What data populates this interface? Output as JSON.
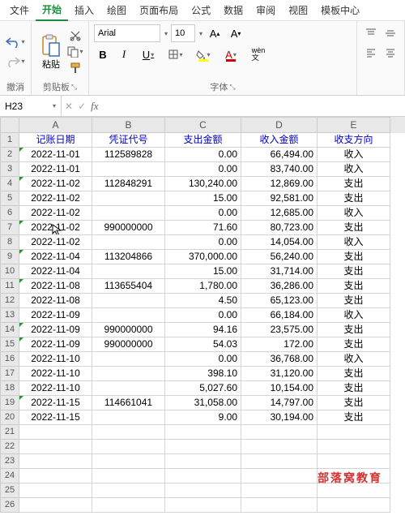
{
  "menu": [
    "文件",
    "开始",
    "插入",
    "绘图",
    "页面布局",
    "公式",
    "数据",
    "审阅",
    "视图",
    "模板中心"
  ],
  "menu_active": 1,
  "ribbon": {
    "undo_label": "撤消",
    "clipboard_label": "剪贴板",
    "paste_label": "粘贴",
    "font_label": "字体",
    "font_name": "Arial",
    "font_size": "10",
    "wen_label": "wèn\n文"
  },
  "cell_ref": "H23",
  "columns": [
    "A",
    "B",
    "C",
    "D",
    "E"
  ],
  "headers": [
    "记账日期",
    "凭证代号",
    "支出金额",
    "收入金额",
    "收支方向"
  ],
  "rows": [
    {
      "d": "2022-11-01",
      "v": "112589828",
      "o": "0.00",
      "i": "66,494.00",
      "t": "收入",
      "f": true
    },
    {
      "d": "2022-11-01",
      "v": "",
      "o": "0.00",
      "i": "83,740.00",
      "t": "收入"
    },
    {
      "d": "2022-11-02",
      "v": "112848291",
      "o": "130,240.00",
      "i": "12,869.00",
      "t": "支出",
      "f": true
    },
    {
      "d": "2022-11-02",
      "v": "",
      "o": "15.00",
      "i": "92,581.00",
      "t": "支出"
    },
    {
      "d": "2022-11-02",
      "v": "",
      "o": "0.00",
      "i": "12,685.00",
      "t": "收入"
    },
    {
      "d": "2022-11-02",
      "v": "990000000",
      "o": "71.60",
      "i": "80,723.00",
      "t": "支出",
      "f": true,
      "cursor": true
    },
    {
      "d": "2022-11-02",
      "v": "",
      "o": "0.00",
      "i": "14,054.00",
      "t": "收入"
    },
    {
      "d": "2022-11-04",
      "v": "113204866",
      "o": "370,000.00",
      "i": "56,240.00",
      "t": "支出",
      "f": true
    },
    {
      "d": "2022-11-04",
      "v": "",
      "o": "15.00",
      "i": "31,714.00",
      "t": "支出"
    },
    {
      "d": "2022-11-08",
      "v": "113655404",
      "o": "1,780.00",
      "i": "36,286.00",
      "t": "支出",
      "f": true
    },
    {
      "d": "2022-11-08",
      "v": "",
      "o": "4.50",
      "i": "65,123.00",
      "t": "支出"
    },
    {
      "d": "2022-11-09",
      "v": "",
      "o": "0.00",
      "i": "66,184.00",
      "t": "收入"
    },
    {
      "d": "2022-11-09",
      "v": "990000000",
      "o": "94.16",
      "i": "23,575.00",
      "t": "支出",
      "f": true
    },
    {
      "d": "2022-11-09",
      "v": "990000000",
      "o": "54.03",
      "i": "172.00",
      "t": "支出",
      "f": true
    },
    {
      "d": "2022-11-10",
      "v": "",
      "o": "0.00",
      "i": "36,768.00",
      "t": "收入"
    },
    {
      "d": "2022-11-10",
      "v": "",
      "o": "398.10",
      "i": "31,120.00",
      "t": "支出"
    },
    {
      "d": "2022-11-10",
      "v": "",
      "o": "5,027.60",
      "i": "10,154.00",
      "t": "支出"
    },
    {
      "d": "2022-11-15",
      "v": "114661041",
      "o": "31,058.00",
      "i": "14,797.00",
      "t": "支出",
      "f": true
    },
    {
      "d": "2022-11-15",
      "v": "",
      "o": "9.00",
      "i": "30,194.00",
      "t": "支出"
    }
  ],
  "empty_rows": [
    21,
    22,
    23,
    24,
    25,
    26
  ],
  "watermark": "部落窝教育"
}
